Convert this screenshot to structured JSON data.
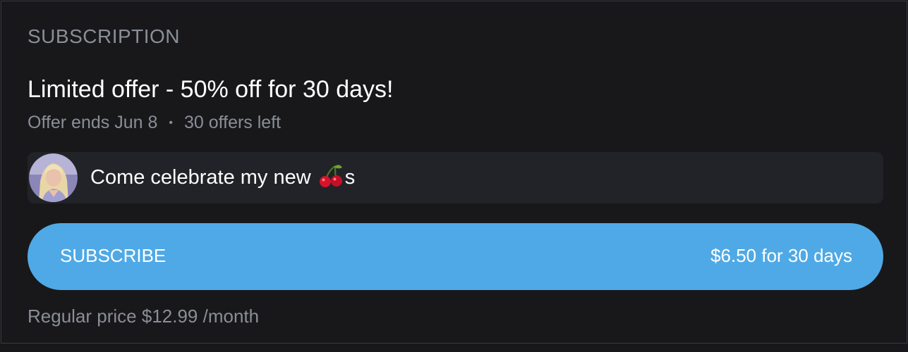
{
  "section_label": "SUBSCRIPTION",
  "offer": {
    "title": "Limited offer - 50% off for 30 days!",
    "ends_text": "Offer ends Jun 8",
    "offers_left_text": "30 offers left"
  },
  "message": {
    "text_before": "Come celebrate my new ",
    "emoji_icon": "cherries-icon",
    "text_after": "s"
  },
  "subscribe_button": {
    "label": "SUBSCRIBE",
    "price_text": "$6.50 for 30 days"
  },
  "regular_price_text": "Regular price $12.99 /month",
  "colors": {
    "background": "#18181b",
    "button": "#4fa9e6",
    "muted_text": "#8a8e96",
    "message_bg": "#222328"
  }
}
